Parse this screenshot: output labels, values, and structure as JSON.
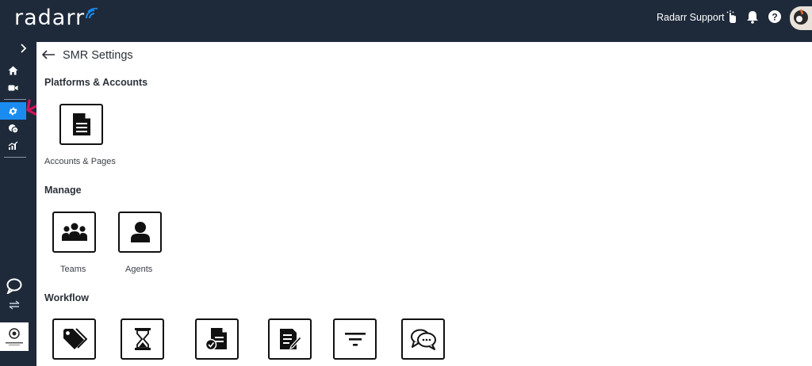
{
  "app": {
    "logo_text": "radarr",
    "user_name": "Radarr Support"
  },
  "header_icons": [
    "gesture-icon",
    "bell-icon",
    "help-icon",
    "avatar"
  ],
  "sidebar": {
    "items": [
      {
        "icon": "home-icon"
      },
      {
        "icon": "video-icon"
      },
      {
        "icon": "gear-icon",
        "active": true
      },
      {
        "icon": "chat-bubbles-icon"
      },
      {
        "icon": "analytics-icon"
      }
    ],
    "bottom_icons": [
      "support-chat-icon",
      "switch-icon"
    ],
    "logo_caption": "Powered by Radarr"
  },
  "page": {
    "title": "SMR Settings"
  },
  "sections": {
    "platforms": {
      "title": "Platforms & Accounts",
      "tiles": [
        {
          "label": "Accounts & Pages",
          "icon": "document-icon"
        }
      ]
    },
    "manage": {
      "title": "Manage",
      "tiles": [
        {
          "label": "Teams",
          "icon": "team-icon"
        },
        {
          "label": "Agents",
          "icon": "user-icon"
        }
      ]
    },
    "workflow": {
      "title": "Workflow",
      "tiles": [
        {
          "icon": "tags-icon"
        },
        {
          "icon": "hourglass-icon"
        },
        {
          "icon": "approved-document-icon"
        },
        {
          "icon": "edit-document-icon"
        },
        {
          "icon": "filter-icon"
        },
        {
          "icon": "conversation-icon"
        }
      ]
    }
  },
  "colors": {
    "nav_bg": "#1e2a3a",
    "active_item": "#1a8cf0",
    "annotation_arrow": "#d4145a",
    "logo_accent": "#1a8cf0"
  }
}
